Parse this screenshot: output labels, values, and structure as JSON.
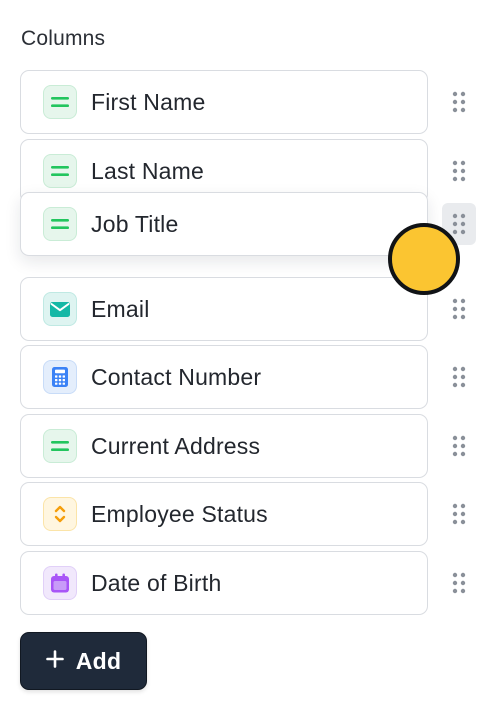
{
  "panel": {
    "title": "Columns",
    "colors": {
      "text_field": "#22c55e",
      "email_field": "#14b8a6",
      "number_field": "#3b82f6",
      "select_field": "#f59e0b",
      "date_field": "#a855f7",
      "add_button_bg": "#1f2a3a",
      "drag_cursor": "#fbc531"
    }
  },
  "columns": [
    {
      "label": "First Name",
      "icon": "text-field-icon"
    },
    {
      "label": "Last Name",
      "icon": "text-field-icon"
    },
    {
      "label": "Job Title",
      "icon": "text-field-icon",
      "state": "dragging"
    },
    {
      "label": "Email",
      "icon": "email-icon"
    },
    {
      "label": "Contact Number",
      "icon": "number-field-icon"
    },
    {
      "label": "Current Address",
      "icon": "text-field-icon"
    },
    {
      "label": "Employee Status",
      "icon": "select-field-icon"
    },
    {
      "label": "Date of Birth",
      "icon": "calendar-icon"
    }
  ],
  "add_button": {
    "label": "Add",
    "icon": "plus-icon"
  }
}
